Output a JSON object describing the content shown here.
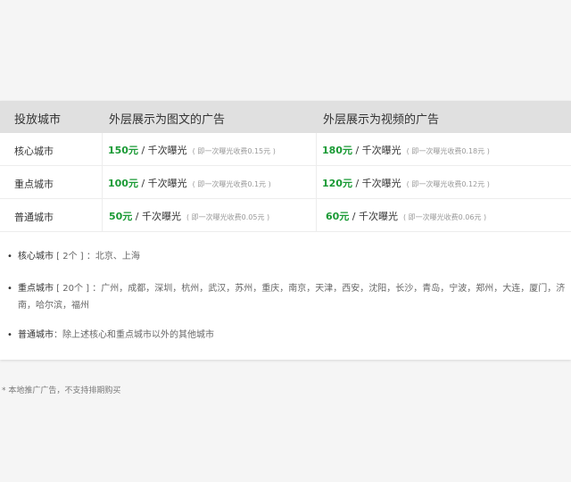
{
  "table": {
    "headers": [
      "投放城市",
      "外层展示为图文的广告",
      "外层展示为视频的广告"
    ],
    "rows": [
      {
        "city": "核心城市",
        "image_text": {
          "amount": "150元",
          "unit": " / 千次曝光",
          "note": "( 即一次曝光收费0.15元 )"
        },
        "video": {
          "amount": "180元",
          "unit": " / 千次曝光",
          "note": "( 即一次曝光收费0.18元 )"
        }
      },
      {
        "city": "重点城市",
        "image_text": {
          "amount": "100元",
          "unit": " / 千次曝光",
          "note": "( 即一次曝光收费0.1元 )"
        },
        "video": {
          "amount": "120元",
          "unit": " / 千次曝光",
          "note": "( 即一次曝光收费0.12元 )"
        }
      },
      {
        "city": "普通城市",
        "image_text": {
          "amount": "50元",
          "unit": " / 千次曝光",
          "note": "( 即一次曝光收费0.05元 )"
        },
        "video": {
          "amount": "60元",
          "unit": " / 千次曝光",
          "note": "( 即一次曝光收费0.06元 )"
        }
      }
    ]
  },
  "notes": [
    {
      "bullet": "•",
      "label": "核心城市",
      "text": " [ 2个 ] ：北京、上海"
    },
    {
      "bullet": "•",
      "label": "重点城市",
      "text": " [ 20个 ] ：广州，成都，深圳，杭州，武汉，苏州，重庆，南京，天津，西安，沈阳，长沙，青岛，宁波，郑州，大连，厦门，济南，哈尔滨，福州"
    },
    {
      "bullet": "•",
      "label": "普通城市",
      "text": "：除上述核心和重点城市以外的其他城市"
    }
  ],
  "footer": "* 本地推广广告，不支持排期购买"
}
